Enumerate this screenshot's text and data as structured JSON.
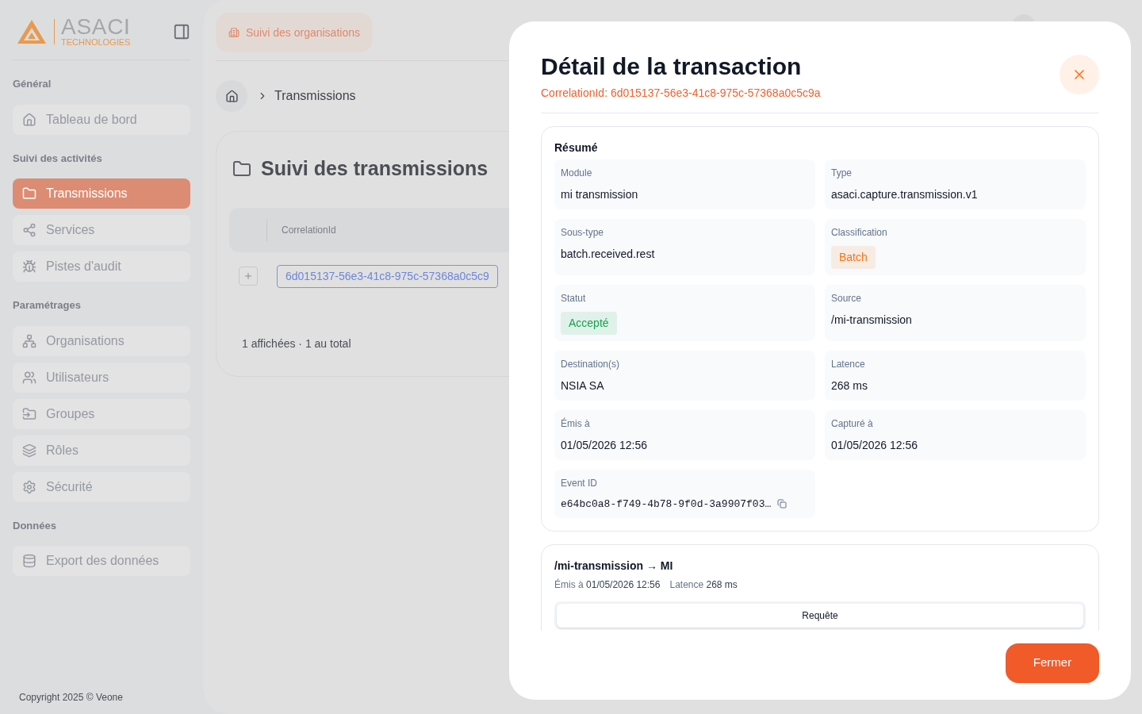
{
  "logo": {
    "name": "ASACI",
    "subtitle": "TECHNOLOGIES"
  },
  "sidebar": {
    "sections": [
      {
        "title": "Général",
        "items": [
          {
            "label": "Tableau de bord",
            "kind": "home",
            "selected": false
          }
        ]
      },
      {
        "title": "Suivi des activités",
        "items": [
          {
            "label": "Transmissions",
            "kind": "folder",
            "selected": true
          },
          {
            "label": "Services",
            "kind": "services",
            "selected": false
          },
          {
            "label": "Pistes d'audit",
            "kind": "bug",
            "selected": false
          }
        ]
      },
      {
        "title": "Paramétrages",
        "items": [
          {
            "label": "Organisations",
            "kind": "org",
            "selected": false
          },
          {
            "label": "Utilisateurs",
            "kind": "users",
            "selected": false
          },
          {
            "label": "Groupes",
            "kind": "group",
            "selected": false
          },
          {
            "label": "Rôles",
            "kind": "layers",
            "selected": false
          },
          {
            "label": "Sécurité",
            "kind": "gear",
            "selected": false
          }
        ]
      },
      {
        "title": "Données",
        "items": [
          {
            "label": "Export des données",
            "kind": "database",
            "selected": false
          }
        ]
      }
    ],
    "copyright": "Copyright 2025 © Veone"
  },
  "topbar": {
    "org_button": "Suivi des organisations"
  },
  "breadcrumb": [
    "Transmissions"
  ],
  "page": {
    "title": "Suivi des transmissions",
    "table": {
      "columns": [
        "CorrelationId"
      ],
      "rows": [
        {
          "correlation_id": "6d015137-56e3-41c8-975c-57368a0c5c9"
        }
      ]
    },
    "footer": "1 affichées · 1 au total"
  },
  "modal": {
    "title": "Détail de la transaction",
    "subtitle": "CorrelationId: 6d015137-56e3-41c8-975c-57368a0c5c9a",
    "summary": {
      "title": "Résumé",
      "fields": [
        {
          "label": "Module",
          "value": "mi transmission",
          "kind": "text"
        },
        {
          "label": "Type",
          "value": "asaci.capture.transmission.v1",
          "kind": "text"
        },
        {
          "label": "Sous-type",
          "value": "batch.received.rest",
          "kind": "text"
        },
        {
          "label": "Classification",
          "value": "Batch",
          "kind": "badge",
          "color": "#f97316"
        },
        {
          "label": "Statut",
          "value": "Accepté",
          "kind": "badge",
          "color": "#16a34a"
        },
        {
          "label": "Source",
          "value": "/mi-transmission",
          "kind": "text"
        },
        {
          "label": "Destination(s)",
          "value": "NSIA SA",
          "kind": "text"
        },
        {
          "label": "Latence",
          "value": "268 ms",
          "kind": "text"
        },
        {
          "label": "Émis à",
          "value": "01/05/2026 12:56",
          "kind": "text"
        },
        {
          "label": "Capturé à",
          "value": "01/05/2026 12:56",
          "kind": "text"
        },
        {
          "label": "Event ID",
          "value": "e64bc0a8-f749-4b78-9f0d-3a9907f03…",
          "kind": "code"
        }
      ]
    },
    "hop": {
      "title": "/mi-transmission → MI",
      "emitted_label": "Émis à",
      "emitted_value": "01/05/2026 12:56",
      "latency_label": "Latence",
      "latency_value": "268 ms",
      "tab": "Requête"
    },
    "close_button": "Fermer"
  }
}
